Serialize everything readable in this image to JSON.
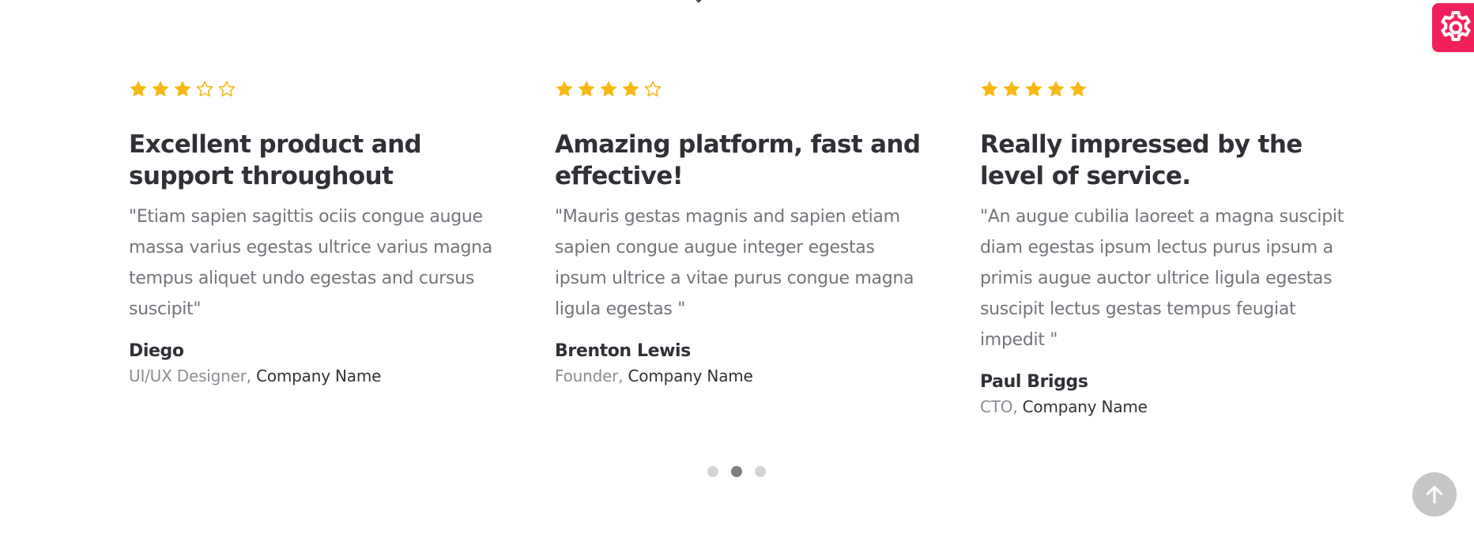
{
  "colors": {
    "star": "#f9b813",
    "heading": "#2f3137",
    "body_text": "#72757b",
    "muted": "#8a8d93",
    "settings_bg": "#f0215a",
    "scroll_btn_bg": "#c6c7c9",
    "dot_inactive": "#d3d4d6",
    "dot_active": "#7b7e82"
  },
  "testimonials": [
    {
      "rating": 3,
      "max_rating": 5,
      "title": "Excellent product and support throughout",
      "quote": "\"Etiam sapien sagittis ociis congue augue massa varius egestas ultrice varius magna tempus aliquet undo egestas and cursus suscipit\"",
      "author": "Diego",
      "role": "UI/UX Designer,",
      "company": "Company Name"
    },
    {
      "rating": 4,
      "max_rating": 5,
      "title": "Amazing platform, fast and effective!",
      "quote": "\"Mauris gestas magnis and sapien etiam sapien congue augue integer egestas ipsum ultrice a vitae purus congue magna ligula egestas \"",
      "author": "Brenton Lewis",
      "role": "Founder,",
      "company": "Company Name"
    },
    {
      "rating": 5,
      "max_rating": 5,
      "title": "Really impressed by the level of service.",
      "quote": "\"An augue cubilia laoreet a magna suscipit diam egestas ipsum lectus purus ipsum a primis augue auctor ultrice ligula egestas suscipit lectus gestas tempus feugiat impedit \"",
      "author": "Paul Briggs",
      "role": "CTO,",
      "company": "Company Name"
    }
  ],
  "pagination": {
    "total": 3,
    "active_index": 1
  },
  "icons": {
    "settings": "gear-icon",
    "scroll_top": "arrow-up-icon",
    "star_filled": "star-filled-icon",
    "star_empty": "star-outline-icon"
  }
}
